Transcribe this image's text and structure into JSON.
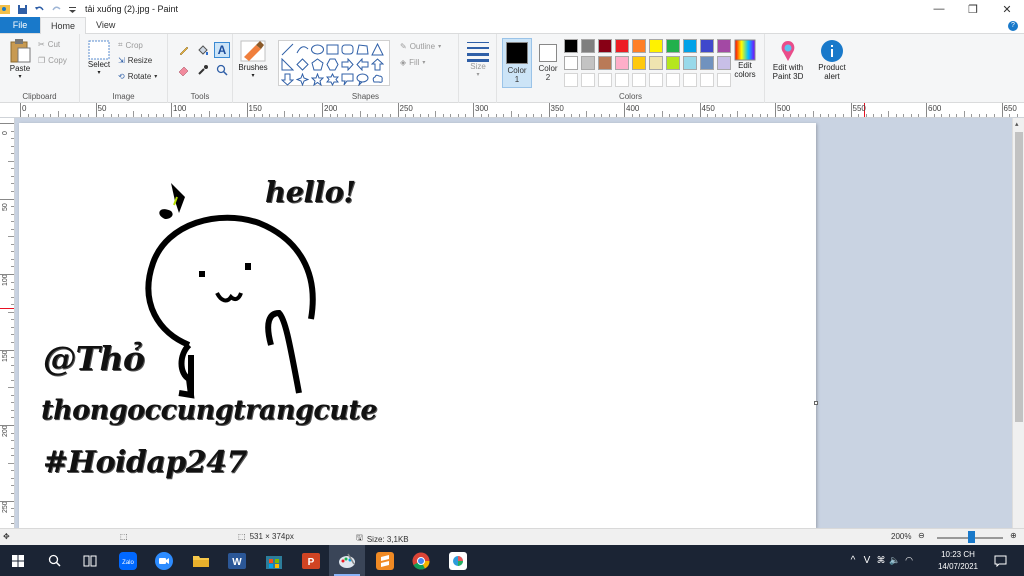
{
  "window": {
    "title": "tải xuống (2).jpg - Paint",
    "controls": {
      "minimize": "—",
      "maximize": "❐",
      "close": "✕"
    }
  },
  "tabs": {
    "file": "File",
    "home": "Home",
    "view": "View"
  },
  "ribbon": {
    "clipboard": {
      "paste": "Paste",
      "cut": "Cut",
      "copy": "Copy",
      "label": "Clipboard"
    },
    "image": {
      "select": "Select",
      "crop": "Crop",
      "resize": "Resize",
      "rotate": "Rotate",
      "label": "Image"
    },
    "tools": {
      "label": "Tools"
    },
    "brushes": {
      "label": "Brushes"
    },
    "shapes": {
      "outline": "Outline",
      "fill": "Fill",
      "label": "Shapes"
    },
    "size": {
      "label": "Size"
    },
    "colors": {
      "color1": "Color",
      "color1_num": "1",
      "color2": "Color",
      "color2_num": "2",
      "edit_colors": "Edit colors",
      "label": "Colors",
      "color1_value": "#000000",
      "color2_value": "#ffffff",
      "palette_row1": [
        "#000000",
        "#7f7f7f",
        "#880015",
        "#ed1c24",
        "#ff7f27",
        "#fff200",
        "#22b14c",
        "#00a2e8",
        "#3f48cc",
        "#a349a4"
      ],
      "palette_row2": [
        "#ffffff",
        "#c3c3c3",
        "#b97a57",
        "#ffaec9",
        "#ffc90e",
        "#efe4b0",
        "#b5e61d",
        "#99d9ea",
        "#7092be",
        "#c8bfe7"
      ]
    },
    "paint3d": "Edit with Paint 3D",
    "product_alert": "Product alert"
  },
  "ruler": {
    "top": [
      "0",
      "50",
      "100",
      "150",
      "200",
      "250",
      "300",
      "350",
      "400",
      "450",
      "500",
      "550",
      "600",
      "650"
    ],
    "left": [
      "0",
      "50",
      "100",
      "150",
      "200",
      "250"
    ]
  },
  "canvas_text": {
    "hello": "hello!",
    "tho": "@Thỏ",
    "username": "thongoccungtrangcute",
    "hashtag": "#Hoidap247"
  },
  "status": {
    "dimensions": "531 × 374px",
    "size": "Size: 3,1KB",
    "zoom": "200%"
  },
  "taskbar": {
    "time": "10:23 CH",
    "date": "14/07/2021",
    "tray_lang": "V"
  }
}
